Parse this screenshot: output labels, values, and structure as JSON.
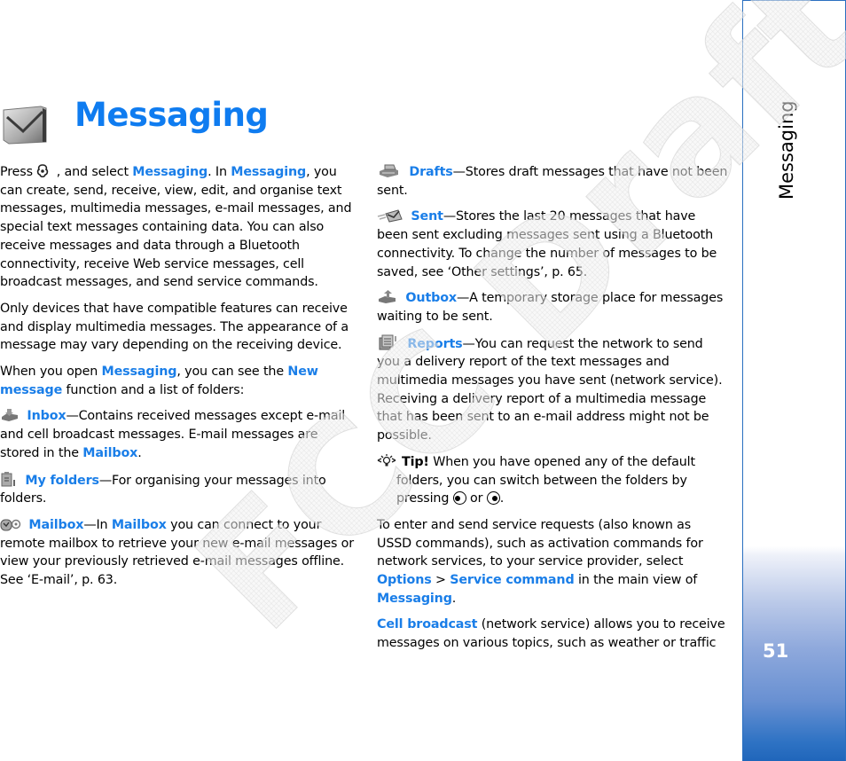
{
  "header": {
    "chapter_title": "Messaging",
    "chapter_icon": "envelope-icon"
  },
  "sidebar": {
    "section_label": "Messaging",
    "page_number": "51",
    "accent_color": "#1f65ba"
  },
  "watermark": {
    "text": "FCC Draft"
  },
  "colors": {
    "highlight": "#1a7ee8",
    "title": "#0f7cf0"
  },
  "left_column": {
    "intro": {
      "t1": "Press ",
      "menu_key_icon": "menu-key-icon",
      "t2": " , and select ",
      "h1": "Messaging",
      "t3": ". In ",
      "h2": "Messaging",
      "t4": ", you can create, send, receive, view, edit, and organise text messages, multimedia messages, e-mail messages, and special text messages containing data. You can also receive messages and data through a Bluetooth connectivity, receive Web service messages, cell broadcast messages, and send service commands."
    },
    "compat": "Only devices that have compatible features can receive and display multimedia messages. The appearance of a message may vary depending on the receiving device.",
    "open": {
      "t1": "When you open ",
      "h1": "Messaging",
      "t2": ", you can see the ",
      "h2": "New message",
      "t3": " function and a list of folders:"
    },
    "inbox": {
      "icon": "inbox-icon",
      "label": "Inbox",
      "t1": "—Contains received messages except e-mail and cell broadcast messages. E-mail messages are stored in the ",
      "h1": "Mailbox",
      "t2": "."
    },
    "my_folders": {
      "icon": "my-folders-icon",
      "label": "My folders",
      "t1": "—For organising your messages into folders."
    },
    "mailbox": {
      "icon": "mailbox-icon",
      "label": "Mailbox",
      "t1": "—In ",
      "h1": "Mailbox",
      "t2": " you can connect to your remote mailbox to retrieve your new e-mail messages or view your previously retrieved e-mail messages offline. See ‘E-mail’, p. 63."
    }
  },
  "right_column": {
    "drafts": {
      "icon": "drafts-icon",
      "label": "Drafts",
      "t1": "—Stores draft messages that have not been sent."
    },
    "sent": {
      "icon": "sent-icon",
      "label": "Sent",
      "t1": "—Stores the last 20 messages that have been sent excluding messages sent using a Bluetooth connectivity. To change the number of messages to be saved, see ‘Other settings’, p. 65."
    },
    "outbox": {
      "icon": "outbox-icon",
      "label": "Outbox",
      "t1": "—A temporary storage place for messages waiting to be sent."
    },
    "reports": {
      "icon": "reports-icon",
      "label": "Reports",
      "t1": "—You can request the network to send you a delivery report of the text messages and multimedia messages you have sent (network service). Receiving a delivery report of a multimedia message that has been sent to an e-mail address might not be possible."
    },
    "tip": {
      "icon": "tip-lightbulb-icon",
      "label": "Tip!",
      "t1": " When you have opened any of the default folders, you can switch between the folders by pressing ",
      "or": " or ",
      "end": "."
    },
    "ussd": {
      "t1": "To enter and send service requests (also known as USSD commands), such as activation commands for network services, to your service provider, select ",
      "h1": "Options",
      "t2": " > ",
      "h2": "Service command",
      "t3": " in the main view of ",
      "h3": "Messaging",
      "t4": "."
    },
    "cell_broadcast": {
      "h1": "Cell broadcast",
      "t1": " (network service) allows you to receive messages on various topics, such as weather or traffic"
    }
  }
}
